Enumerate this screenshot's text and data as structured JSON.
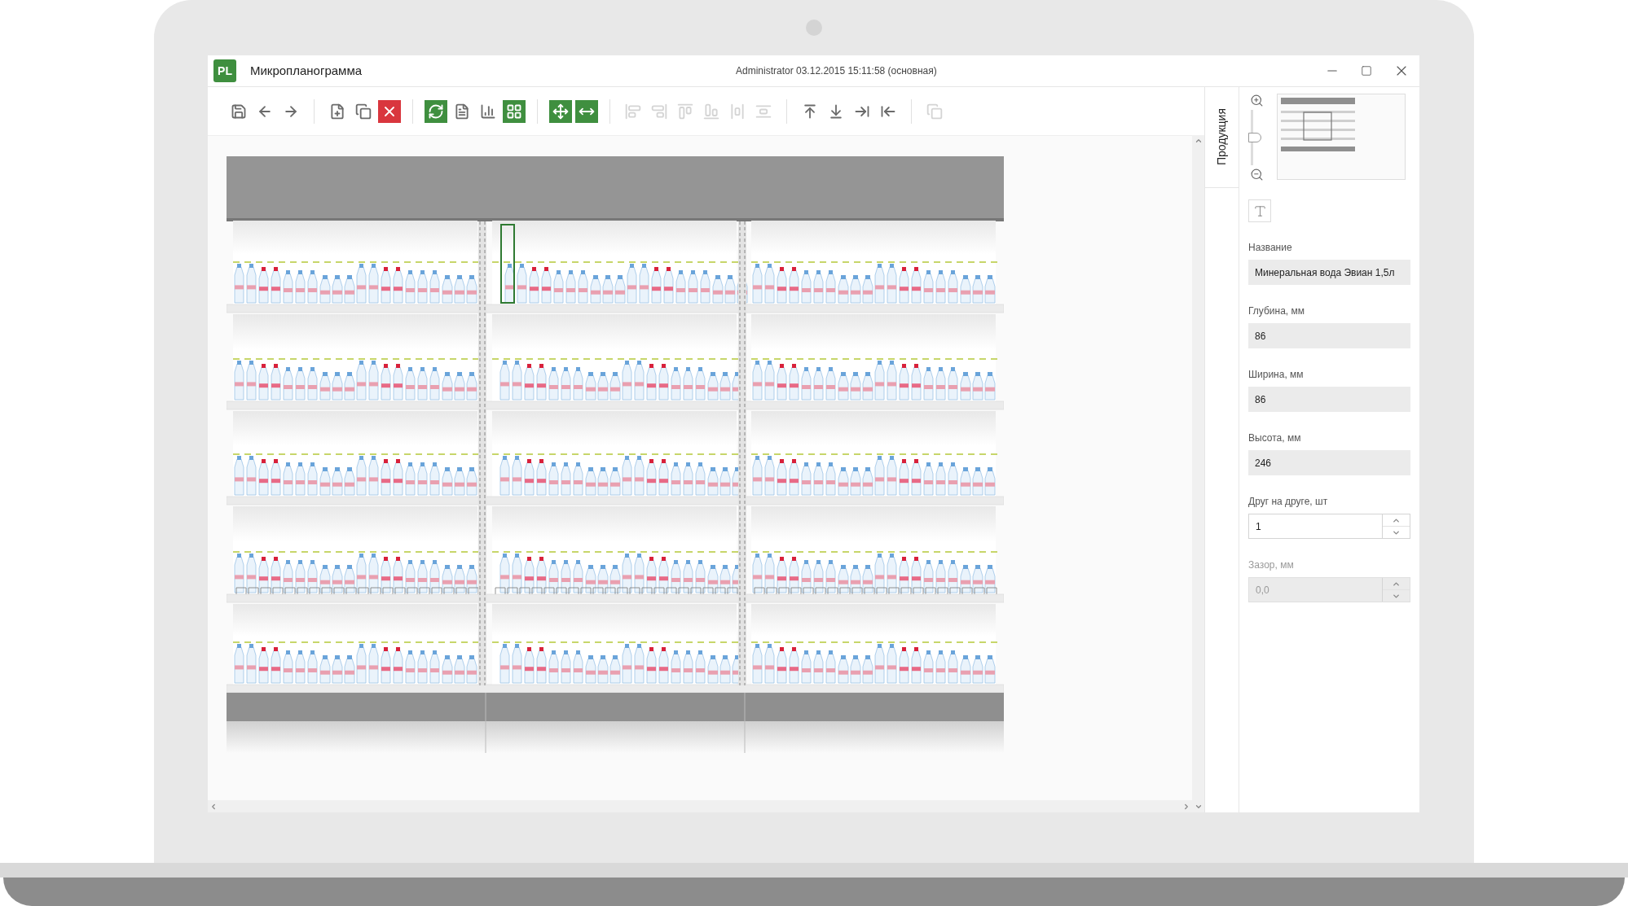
{
  "window": {
    "logo": "PL",
    "title": "Микропланограмма",
    "info": "Administrator 03.12.2015 15:11:58 (основная)"
  },
  "toolbar": [
    [
      {
        "kind": "save",
        "active": false,
        "disabled": false
      },
      {
        "kind": "back",
        "active": false,
        "disabled": false
      },
      {
        "kind": "forward",
        "active": false,
        "disabled": false
      }
    ],
    [
      {
        "kind": "new",
        "active": false,
        "disabled": false
      },
      {
        "kind": "copy",
        "active": false,
        "disabled": false
      },
      {
        "kind": "delete",
        "active": false,
        "disabled": false
      }
    ],
    [
      {
        "kind": "refresh",
        "active": true,
        "disabled": false
      },
      {
        "kind": "document",
        "active": false,
        "disabled": false
      },
      {
        "kind": "chart",
        "active": false,
        "disabled": false
      },
      {
        "kind": "layout",
        "active": true,
        "disabled": false
      }
    ],
    [
      {
        "kind": "move",
        "active": true,
        "disabled": false
      },
      {
        "kind": "resize",
        "active": true,
        "disabled": false
      }
    ],
    [
      {
        "kind": "align-left",
        "active": false,
        "disabled": true
      },
      {
        "kind": "align-right",
        "active": false,
        "disabled": true
      },
      {
        "kind": "align-top",
        "active": false,
        "disabled": true
      },
      {
        "kind": "align-bottom",
        "active": false,
        "disabled": true
      },
      {
        "kind": "space-horizontal",
        "active": false,
        "disabled": true
      },
      {
        "kind": "space-vertical",
        "active": false,
        "disabled": true
      }
    ],
    [
      {
        "kind": "to-top",
        "active": false,
        "disabled": false
      },
      {
        "kind": "to-bottom",
        "active": false,
        "disabled": false
      },
      {
        "kind": "to-right",
        "active": false,
        "disabled": false
      },
      {
        "kind": "to-left",
        "active": false,
        "disabled": false
      }
    ],
    [
      {
        "kind": "overlap",
        "active": false,
        "disabled": true
      }
    ]
  ],
  "side_tabs": [
    {
      "label": "Продукция",
      "selected": true
    }
  ],
  "zoom": {
    "level": 0.5
  },
  "fields": [
    {
      "kind": "text",
      "label": "Название",
      "value": "Минеральная вода Эвиан 1,5л",
      "disabled": false
    },
    {
      "kind": "text",
      "label": "Глубина, мм",
      "value": "86",
      "disabled": false
    },
    {
      "kind": "text",
      "label": "Ширина, мм",
      "value": "86",
      "disabled": false
    },
    {
      "kind": "text",
      "label": "Высота, мм",
      "value": "246",
      "disabled": false
    },
    {
      "kind": "spinner",
      "label": "Друг на друге, шт",
      "value": "1",
      "disabled": false
    },
    {
      "kind": "spinner",
      "label": "Зазор, мм",
      "value": "0,0",
      "disabled": true
    }
  ]
}
